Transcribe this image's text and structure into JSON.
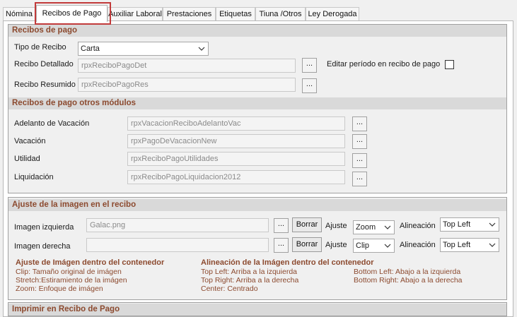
{
  "tabs": [
    {
      "label": "Nómina"
    },
    {
      "label": "Recibos de Pago"
    },
    {
      "label": "Auxiliar Laboral"
    },
    {
      "label": "Prestaciones"
    },
    {
      "label": "Etiquetas"
    },
    {
      "label": "Tiuna /Otros"
    },
    {
      "label": "Ley Derogada"
    }
  ],
  "recibos": {
    "title": "Recibos de pago",
    "tipo_label": "Tipo de Recibo",
    "tipo_value": "Carta",
    "detallado_label": "Recibo Detallado",
    "detallado_value": "rpxReciboPagoDet",
    "resumido_label": "Recibo Resumido",
    "resumido_value": "rpxReciboPagoRes",
    "editar_label": "Editar período en recibo de pago",
    "browse_label": "..."
  },
  "otros": {
    "title": "Recibos de pago otros módulos",
    "rows": [
      {
        "label": "Adelanto de Vacación",
        "value": "rpxVacacionReciboAdelantoVac"
      },
      {
        "label": "Vacación",
        "value": "rpxPagoDeVacacionNew"
      },
      {
        "label": "Utilidad",
        "value": "rpxReciboPagoUtilidades"
      },
      {
        "label": "Liquidación",
        "value": "rpxReciboPagoLiquidacion2012"
      }
    ]
  },
  "ajuste": {
    "title": "Ajuste de la imagen en el recibo",
    "izq_label": "Imagen izquierda",
    "izq_value": "Galac.png",
    "der_label": "Imagen derecha",
    "der_value": "",
    "borrar_label": "Borrar",
    "ajuste_label": "Ajuste",
    "alineacion_label": "Alineación",
    "izq_ajuste": "Zoom",
    "der_ajuste": "Clip",
    "izq_alineacion": "Top Left",
    "der_alineacion": "Top Left",
    "legend1_title": "Ajuste de Imágen dentro del contenedor",
    "legend1_items": [
      "Clip: Tamaño original de imágen",
      "Stretch:Estiramiento de la imágen",
      "Zoom: Enfoque de imágen"
    ],
    "legend2_title": "Alineación de la Imágen dentro del contenedor",
    "legend2_items": [
      "Top Left:  Arriba a la izquierda",
      "Top Right: Arriba a la derecha",
      "Center: Centrado"
    ],
    "legend3_items": [
      "Bottom Left:  Abajo a la izquierda",
      "Bottom Right: Abajo a la derecha"
    ]
  },
  "imprimir": {
    "title": "Imprimir en Recibo de Pago"
  }
}
